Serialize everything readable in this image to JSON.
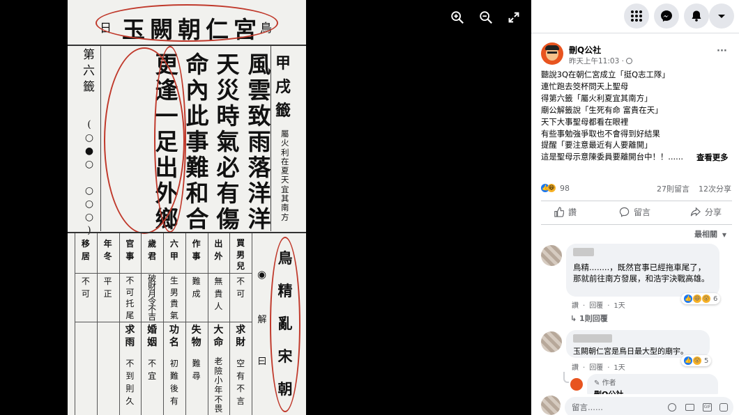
{
  "viewer": {
    "tools": [
      {
        "icon": "zoom-in-icon"
      },
      {
        "icon": "zoom-out-icon"
      },
      {
        "icon": "fullscreen-icon"
      }
    ]
  },
  "fortune_slip": {
    "header_left": "日",
    "header_title": "玉闕朝仁宮",
    "header_right": "鳥",
    "right_label": "甲戌籤",
    "right_note": "屬火利在夏天宜其南方",
    "left_label": "第六籤",
    "left_marks": "(○●○ ○○○)",
    "poem": [
      "風雲致雨落洋洋",
      "天災時氣必有傷",
      "命內此事難和合",
      "更逢一足出外鄉"
    ],
    "explain_mark": "◉",
    "explain_label": "解曰",
    "explain_chars": "鳥精亂宋朝",
    "table_headers": [
      "買男兒",
      "出外",
      "作事",
      "六甲",
      "歲君",
      "官事",
      "年冬",
      "移居"
    ],
    "table_row1": [
      "不可",
      "無貴人",
      "難成",
      "生男貴氣",
      "破財月令不吉",
      "不可托尾",
      "平正",
      "不可"
    ],
    "table_row2": [
      "求財",
      "大命",
      "失物",
      "功名",
      "婚姻",
      "求雨",
      "",
      ""
    ],
    "table_row3": [
      "空有不言",
      "老險小年不畏",
      "難尋",
      "初難後有",
      "不宜",
      "不到則久",
      "",
      ""
    ]
  },
  "topbar": {
    "icons": [
      "grid-menu-icon",
      "messenger-icon",
      "notifications-bell-icon",
      "account-dropdown-icon"
    ]
  },
  "post": {
    "author": "刪Q公社",
    "time": "昨天上午11:03",
    "privacy": "·",
    "more": "···",
    "lines": [
      "聽說3Q在朝仁宮成立「挺Q志工隊」",
      "連忙跑去筊杯問天上聖母",
      "得第六籤「屬火利夏宜其南方」",
      "廟公解籤說「生死有命 富貴在天」",
      "天下大事聖母都看在眼裡",
      "有些事勉強爭取也不會得到好結果",
      "提醒「要注意最近有人要離開」",
      "這是聖母示意陳委員要離開台中！！......"
    ],
    "see_more": "查看更多",
    "reactions_count": "98",
    "comments_count": "27則留言",
    "shares_count": "12次分享",
    "actions": {
      "like": "讚",
      "comment": "留言",
      "share": "分享"
    },
    "sort": "最相關"
  },
  "comments": [
    {
      "text": "鳥精........，既然官事已經拖車尾了，那就前往南方發展，和浩宇決戰高雄。",
      "meta_like": "讚",
      "meta_reply": "回覆",
      "meta_time": "1天",
      "reacts": "6",
      "replies": "1則回覆"
    },
    {
      "text": "玉闕朝仁宮是鳥日最大型的廟宇。",
      "meta_like": "讚",
      "meta_reply": "回覆",
      "meta_time": "1天",
      "reacts": "5"
    }
  ],
  "author_reply": {
    "badge": "作者",
    "name": "刪Q公社"
  },
  "composer": {
    "placeholder": "留言......",
    "icons": [
      "emoji-icon",
      "camera-icon",
      "gif-icon",
      "sticker-icon"
    ]
  },
  "colors": {
    "accent": "#1877f2",
    "ink_red": "#c0392b"
  }
}
